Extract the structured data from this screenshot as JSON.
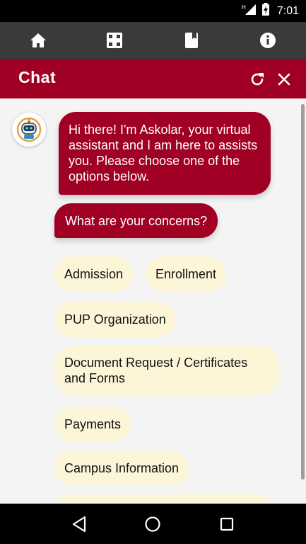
{
  "status_bar": {
    "network": "H",
    "time": "7:01"
  },
  "top_nav": {
    "items": [
      {
        "icon": "home-icon"
      },
      {
        "icon": "organization-icon"
      },
      {
        "icon": "book-icon"
      },
      {
        "icon": "info-icon"
      }
    ]
  },
  "header": {
    "title": "Chat",
    "refresh_icon": "refresh-icon",
    "close_icon": "close-icon"
  },
  "chat": {
    "greeting": "Hi there! I'm Askolar, your virtual assistant and I am here to assists you. Please choose one of the options below.",
    "question": "What are your concerns?",
    "options": [
      "Admission",
      "Enrollment",
      "PUP Organization",
      "Document Request / Certificates and Forms",
      "Payments",
      "Campus Information",
      ""
    ]
  },
  "colors": {
    "brand": "#a00023",
    "nav_bg": "#3a3a3a",
    "option_bg": "#fdf5d8",
    "chat_bg": "#f4f4f4"
  },
  "android_nav": {
    "back": "back-icon",
    "home": "home-circle-icon",
    "recents": "recents-icon"
  }
}
